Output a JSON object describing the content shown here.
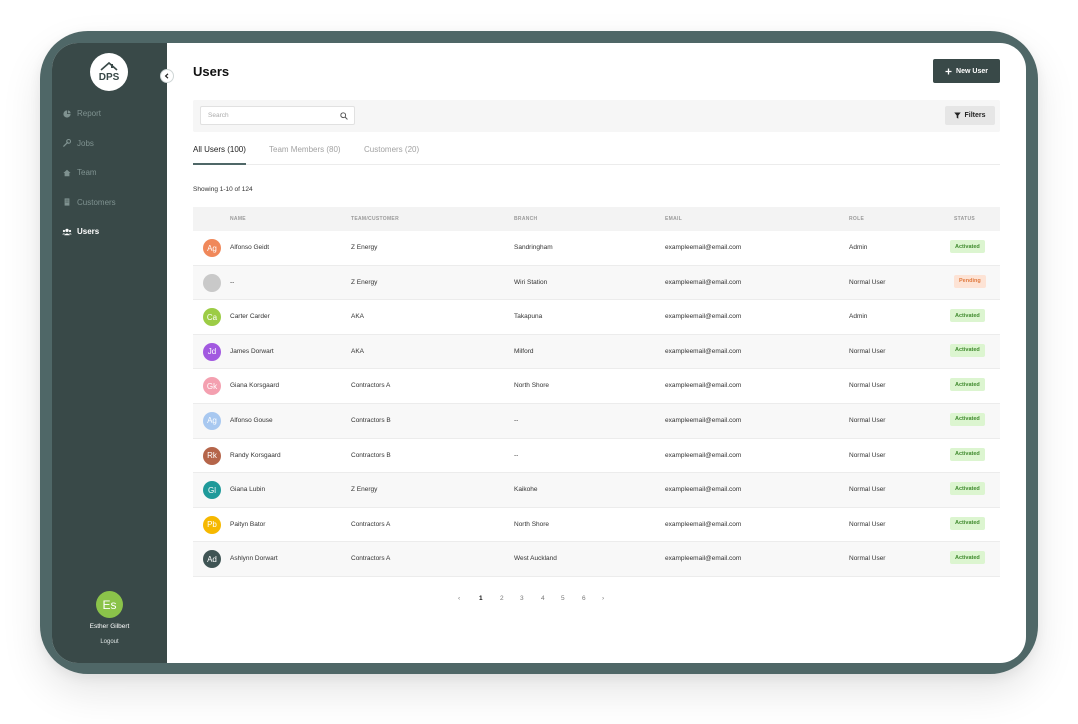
{
  "sidebar": {
    "logo_text": "DPS",
    "items": [
      {
        "label": "Report",
        "icon": "report-icon"
      },
      {
        "label": "Jobs",
        "icon": "wrench-icon"
      },
      {
        "label": "Team",
        "icon": "home-icon"
      },
      {
        "label": "Customers",
        "icon": "building-icon"
      },
      {
        "label": "Users",
        "icon": "users-icon",
        "active": true
      }
    ],
    "user": {
      "initials": "Es",
      "name": "Esther Gilbert",
      "logout": "Logout"
    }
  },
  "header": {
    "title": "Users",
    "new_user_label": "New User"
  },
  "toolbar": {
    "search_placeholder": "Search",
    "filters_label": "Filters"
  },
  "tabs": [
    "All Users (100)",
    "Team Members (80)",
    "Customers (20)"
  ],
  "showing": "Showing 1-10 of 124",
  "table": {
    "columns": [
      "NAME",
      "TEAM/CUSTOMER",
      "BRANCH",
      "EMAIL",
      "ROLE",
      "STATUS"
    ],
    "rows": [
      {
        "initials": "Ag",
        "color": "#f0885a",
        "name": "Alfonso Geidt",
        "team": "Z Energy",
        "branch": "Sandringham",
        "email": "exampleemail@email.com",
        "role": "Admin",
        "status": "Activated"
      },
      {
        "initials": "",
        "color": "#c9c9c9",
        "name": "--",
        "team": "Z Energy",
        "branch": "Wiri Station",
        "email": "exampleemail@email.com",
        "role": "Normal User",
        "status": "Pending"
      },
      {
        "initials": "Ca",
        "color": "#9ccc45",
        "name": "Carter Carder",
        "team": "AKA",
        "branch": "Takapuna",
        "email": "exampleemail@email.com",
        "role": "Admin",
        "status": "Activated"
      },
      {
        "initials": "Jd",
        "color": "#a259e0",
        "name": "James Dorwart",
        "team": "AKA",
        "branch": "Milford",
        "email": "exampleemail@email.com",
        "role": "Normal User",
        "status": "Activated"
      },
      {
        "initials": "Gk",
        "color": "#f4a0b0",
        "name": "Giana Korsgaard",
        "team": "Contractors A",
        "branch": "North Shore",
        "email": "exampleemail@email.com",
        "role": "Normal User",
        "status": "Activated"
      },
      {
        "initials": "Ag",
        "color": "#a8c8f0",
        "name": "Alfonso Gouse",
        "team": "Contractors B",
        "branch": "--",
        "email": "exampleemail@email.com",
        "role": "Normal User",
        "status": "Activated"
      },
      {
        "initials": "Rk",
        "color": "#b5654a",
        "name": "Randy Korsgaard",
        "team": "Contractors B",
        "branch": "--",
        "email": "exampleemail@email.com",
        "role": "Normal User",
        "status": "Activated"
      },
      {
        "initials": "Gl",
        "color": "#1f9a9a",
        "name": "Giana Lubin",
        "team": "Z Energy",
        "branch": "Kaikohe",
        "email": "exampleemail@email.com",
        "role": "Normal User",
        "status": "Activated"
      },
      {
        "initials": "Pb",
        "color": "#f6b800",
        "name": "Paityn Bator",
        "team": "Contractors A",
        "branch": "North Shore",
        "email": "exampleemail@email.com",
        "role": "Normal User",
        "status": "Activated"
      },
      {
        "initials": "Ad",
        "color": "#3f5454",
        "name": "Ashlynn Dorwart",
        "team": "Contractors A",
        "branch": "West Auckland",
        "email": "exampleemail@email.com",
        "role": "Normal User",
        "status": "Activated"
      }
    ]
  },
  "pagination": {
    "prev": "‹",
    "pages": [
      "1",
      "2",
      "3",
      "4",
      "5",
      "6"
    ],
    "current": "1",
    "next": "›"
  }
}
